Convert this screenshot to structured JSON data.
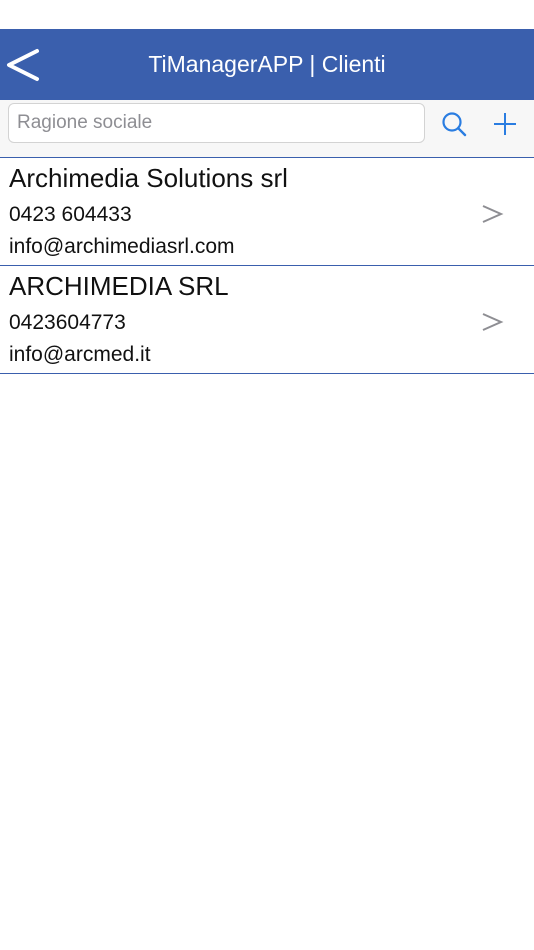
{
  "header": {
    "title": "TiManagerAPP | Clienti",
    "back_icon": "back-chevron-icon",
    "bar_color": "#3a5fad"
  },
  "search": {
    "placeholder": "Ragione sociale",
    "value": "",
    "search_icon": "search-icon",
    "add_icon": "plus-icon",
    "accent_color": "#2a7de1"
  },
  "clients": [
    {
      "name": "Archimedia Solutions srl",
      "phone": "0423 604433",
      "email": "info@archimediasrl.com",
      "icon": "chevron-right-icon"
    },
    {
      "name": "ARCHIMEDIA SRL",
      "phone": "0423604773",
      "email": "info@arcmed.it",
      "icon": "chevron-right-icon"
    }
  ]
}
